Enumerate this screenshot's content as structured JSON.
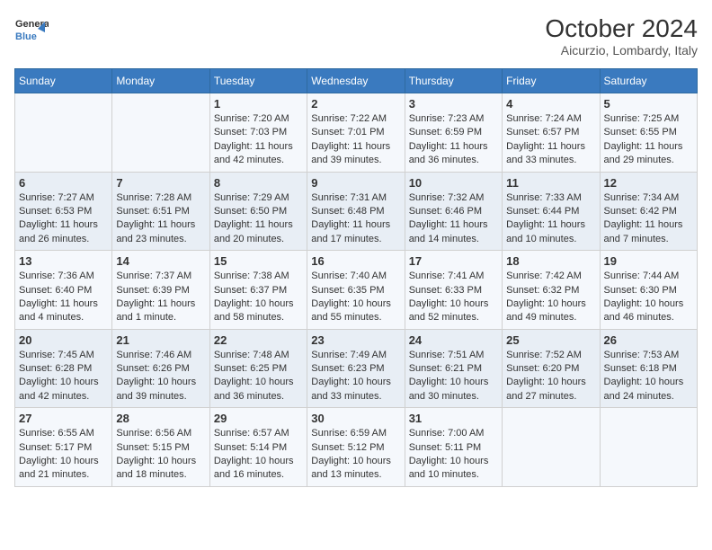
{
  "logo": {
    "line1": "General",
    "line2": "Blue"
  },
  "header": {
    "month_year": "October 2024",
    "location": "Aicurzio, Lombardy, Italy"
  },
  "days_of_week": [
    "Sunday",
    "Monday",
    "Tuesday",
    "Wednesday",
    "Thursday",
    "Friday",
    "Saturday"
  ],
  "weeks": [
    [
      {
        "day": "",
        "info": ""
      },
      {
        "day": "",
        "info": ""
      },
      {
        "day": "1",
        "sunrise": "Sunrise: 7:20 AM",
        "sunset": "Sunset: 7:03 PM",
        "daylight": "Daylight: 11 hours and 42 minutes."
      },
      {
        "day": "2",
        "sunrise": "Sunrise: 7:22 AM",
        "sunset": "Sunset: 7:01 PM",
        "daylight": "Daylight: 11 hours and 39 minutes."
      },
      {
        "day": "3",
        "sunrise": "Sunrise: 7:23 AM",
        "sunset": "Sunset: 6:59 PM",
        "daylight": "Daylight: 11 hours and 36 minutes."
      },
      {
        "day": "4",
        "sunrise": "Sunrise: 7:24 AM",
        "sunset": "Sunset: 6:57 PM",
        "daylight": "Daylight: 11 hours and 33 minutes."
      },
      {
        "day": "5",
        "sunrise": "Sunrise: 7:25 AM",
        "sunset": "Sunset: 6:55 PM",
        "daylight": "Daylight: 11 hours and 29 minutes."
      }
    ],
    [
      {
        "day": "6",
        "sunrise": "Sunrise: 7:27 AM",
        "sunset": "Sunset: 6:53 PM",
        "daylight": "Daylight: 11 hours and 26 minutes."
      },
      {
        "day": "7",
        "sunrise": "Sunrise: 7:28 AM",
        "sunset": "Sunset: 6:51 PM",
        "daylight": "Daylight: 11 hours and 23 minutes."
      },
      {
        "day": "8",
        "sunrise": "Sunrise: 7:29 AM",
        "sunset": "Sunset: 6:50 PM",
        "daylight": "Daylight: 11 hours and 20 minutes."
      },
      {
        "day": "9",
        "sunrise": "Sunrise: 7:31 AM",
        "sunset": "Sunset: 6:48 PM",
        "daylight": "Daylight: 11 hours and 17 minutes."
      },
      {
        "day": "10",
        "sunrise": "Sunrise: 7:32 AM",
        "sunset": "Sunset: 6:46 PM",
        "daylight": "Daylight: 11 hours and 14 minutes."
      },
      {
        "day": "11",
        "sunrise": "Sunrise: 7:33 AM",
        "sunset": "Sunset: 6:44 PM",
        "daylight": "Daylight: 11 hours and 10 minutes."
      },
      {
        "day": "12",
        "sunrise": "Sunrise: 7:34 AM",
        "sunset": "Sunset: 6:42 PM",
        "daylight": "Daylight: 11 hours and 7 minutes."
      }
    ],
    [
      {
        "day": "13",
        "sunrise": "Sunrise: 7:36 AM",
        "sunset": "Sunset: 6:40 PM",
        "daylight": "Daylight: 11 hours and 4 minutes."
      },
      {
        "day": "14",
        "sunrise": "Sunrise: 7:37 AM",
        "sunset": "Sunset: 6:39 PM",
        "daylight": "Daylight: 11 hours and 1 minute."
      },
      {
        "day": "15",
        "sunrise": "Sunrise: 7:38 AM",
        "sunset": "Sunset: 6:37 PM",
        "daylight": "Daylight: 10 hours and 58 minutes."
      },
      {
        "day": "16",
        "sunrise": "Sunrise: 7:40 AM",
        "sunset": "Sunset: 6:35 PM",
        "daylight": "Daylight: 10 hours and 55 minutes."
      },
      {
        "day": "17",
        "sunrise": "Sunrise: 7:41 AM",
        "sunset": "Sunset: 6:33 PM",
        "daylight": "Daylight: 10 hours and 52 minutes."
      },
      {
        "day": "18",
        "sunrise": "Sunrise: 7:42 AM",
        "sunset": "Sunset: 6:32 PM",
        "daylight": "Daylight: 10 hours and 49 minutes."
      },
      {
        "day": "19",
        "sunrise": "Sunrise: 7:44 AM",
        "sunset": "Sunset: 6:30 PM",
        "daylight": "Daylight: 10 hours and 46 minutes."
      }
    ],
    [
      {
        "day": "20",
        "sunrise": "Sunrise: 7:45 AM",
        "sunset": "Sunset: 6:28 PM",
        "daylight": "Daylight: 10 hours and 42 minutes."
      },
      {
        "day": "21",
        "sunrise": "Sunrise: 7:46 AM",
        "sunset": "Sunset: 6:26 PM",
        "daylight": "Daylight: 10 hours and 39 minutes."
      },
      {
        "day": "22",
        "sunrise": "Sunrise: 7:48 AM",
        "sunset": "Sunset: 6:25 PM",
        "daylight": "Daylight: 10 hours and 36 minutes."
      },
      {
        "day": "23",
        "sunrise": "Sunrise: 7:49 AM",
        "sunset": "Sunset: 6:23 PM",
        "daylight": "Daylight: 10 hours and 33 minutes."
      },
      {
        "day": "24",
        "sunrise": "Sunrise: 7:51 AM",
        "sunset": "Sunset: 6:21 PM",
        "daylight": "Daylight: 10 hours and 30 minutes."
      },
      {
        "day": "25",
        "sunrise": "Sunrise: 7:52 AM",
        "sunset": "Sunset: 6:20 PM",
        "daylight": "Daylight: 10 hours and 27 minutes."
      },
      {
        "day": "26",
        "sunrise": "Sunrise: 7:53 AM",
        "sunset": "Sunset: 6:18 PM",
        "daylight": "Daylight: 10 hours and 24 minutes."
      }
    ],
    [
      {
        "day": "27",
        "sunrise": "Sunrise: 6:55 AM",
        "sunset": "Sunset: 5:17 PM",
        "daylight": "Daylight: 10 hours and 21 minutes."
      },
      {
        "day": "28",
        "sunrise": "Sunrise: 6:56 AM",
        "sunset": "Sunset: 5:15 PM",
        "daylight": "Daylight: 10 hours and 18 minutes."
      },
      {
        "day": "29",
        "sunrise": "Sunrise: 6:57 AM",
        "sunset": "Sunset: 5:14 PM",
        "daylight": "Daylight: 10 hours and 16 minutes."
      },
      {
        "day": "30",
        "sunrise": "Sunrise: 6:59 AM",
        "sunset": "Sunset: 5:12 PM",
        "daylight": "Daylight: 10 hours and 13 minutes."
      },
      {
        "day": "31",
        "sunrise": "Sunrise: 7:00 AM",
        "sunset": "Sunset: 5:11 PM",
        "daylight": "Daylight: 10 hours and 10 minutes."
      },
      {
        "day": "",
        "info": ""
      },
      {
        "day": "",
        "info": ""
      }
    ]
  ]
}
